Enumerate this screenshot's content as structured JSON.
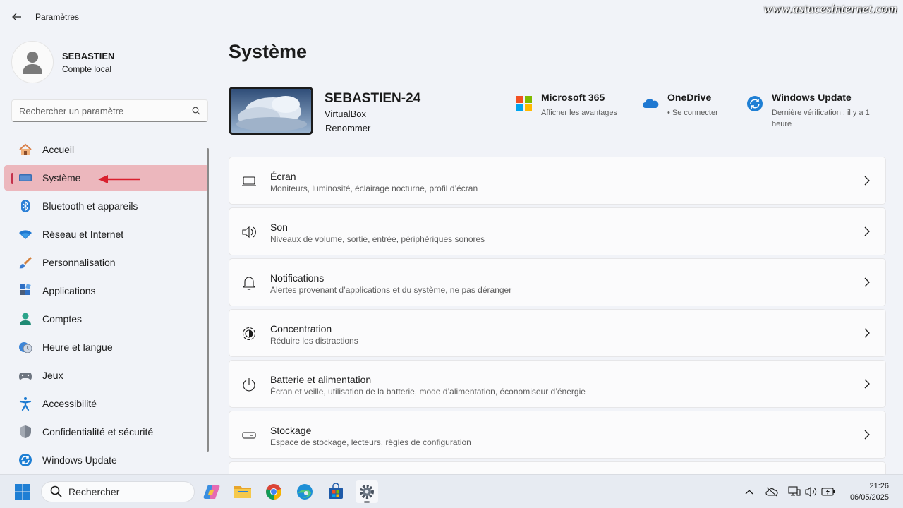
{
  "app": {
    "title": "Paramètres",
    "watermark": "www.astucesinternet.com"
  },
  "profile": {
    "name": "SEBASTIEN",
    "account_type": "Compte local"
  },
  "search": {
    "placeholder": "Rechercher un paramètre"
  },
  "sidebar": {
    "items": [
      {
        "label": "Accueil",
        "icon": "home-icon"
      },
      {
        "label": "Système",
        "icon": "system-icon",
        "active": true
      },
      {
        "label": "Bluetooth et appareils",
        "icon": "bluetooth-icon"
      },
      {
        "label": "Réseau et Internet",
        "icon": "wifi-icon"
      },
      {
        "label": "Personnalisation",
        "icon": "brush-icon"
      },
      {
        "label": "Applications",
        "icon": "apps-icon"
      },
      {
        "label": "Comptes",
        "icon": "accounts-icon"
      },
      {
        "label": "Heure et langue",
        "icon": "time-language-icon"
      },
      {
        "label": "Jeux",
        "icon": "gamepad-icon"
      },
      {
        "label": "Accessibilité",
        "icon": "accessibility-icon"
      },
      {
        "label": "Confidentialité et sécurité",
        "icon": "shield-icon"
      },
      {
        "label": "Windows Update",
        "icon": "update-icon"
      }
    ]
  },
  "main": {
    "title": "Système",
    "device": {
      "name": "SEBASTIEN-24",
      "model": "VirtualBox",
      "rename": "Renommer"
    },
    "quick_links": [
      {
        "title": "Microsoft 365",
        "subtitle": "Afficher les avantages",
        "icon": "microsoft365-icon"
      },
      {
        "title": "OneDrive",
        "subtitle": "Se connecter",
        "icon": "onedrive-icon"
      },
      {
        "title": "Windows Update",
        "subtitle": "Dernière vérification : il y a 1 heure",
        "icon": "windows-update-icon"
      }
    ],
    "cards": [
      {
        "title": "Écran",
        "subtitle": "Moniteurs, luminosité, éclairage nocturne, profil d’écran",
        "icon": "display-icon"
      },
      {
        "title": "Son",
        "subtitle": "Niveaux de volume, sortie, entrée, périphériques sonores",
        "icon": "sound-icon"
      },
      {
        "title": "Notifications",
        "subtitle": "Alertes provenant d’applications et du système, ne pas déranger",
        "icon": "bell-icon"
      },
      {
        "title": "Concentration",
        "subtitle": "Réduire les distractions",
        "icon": "focus-icon"
      },
      {
        "title": "Batterie et alimentation",
        "subtitle": "Écran et veille, utilisation de la batterie, mode d’alimentation, économiseur d’énergie",
        "icon": "power-icon"
      },
      {
        "title": "Stockage",
        "subtitle": "Espace de stockage, lecteurs, règles de configuration",
        "icon": "storage-icon"
      }
    ]
  },
  "taskbar": {
    "search_label": "Rechercher",
    "time": "21:26",
    "date": "06/05/2025"
  },
  "colors": {
    "active_highlight": "#ecb7bd",
    "active_indicator": "#c4314b",
    "arrow": "#d9202e"
  }
}
